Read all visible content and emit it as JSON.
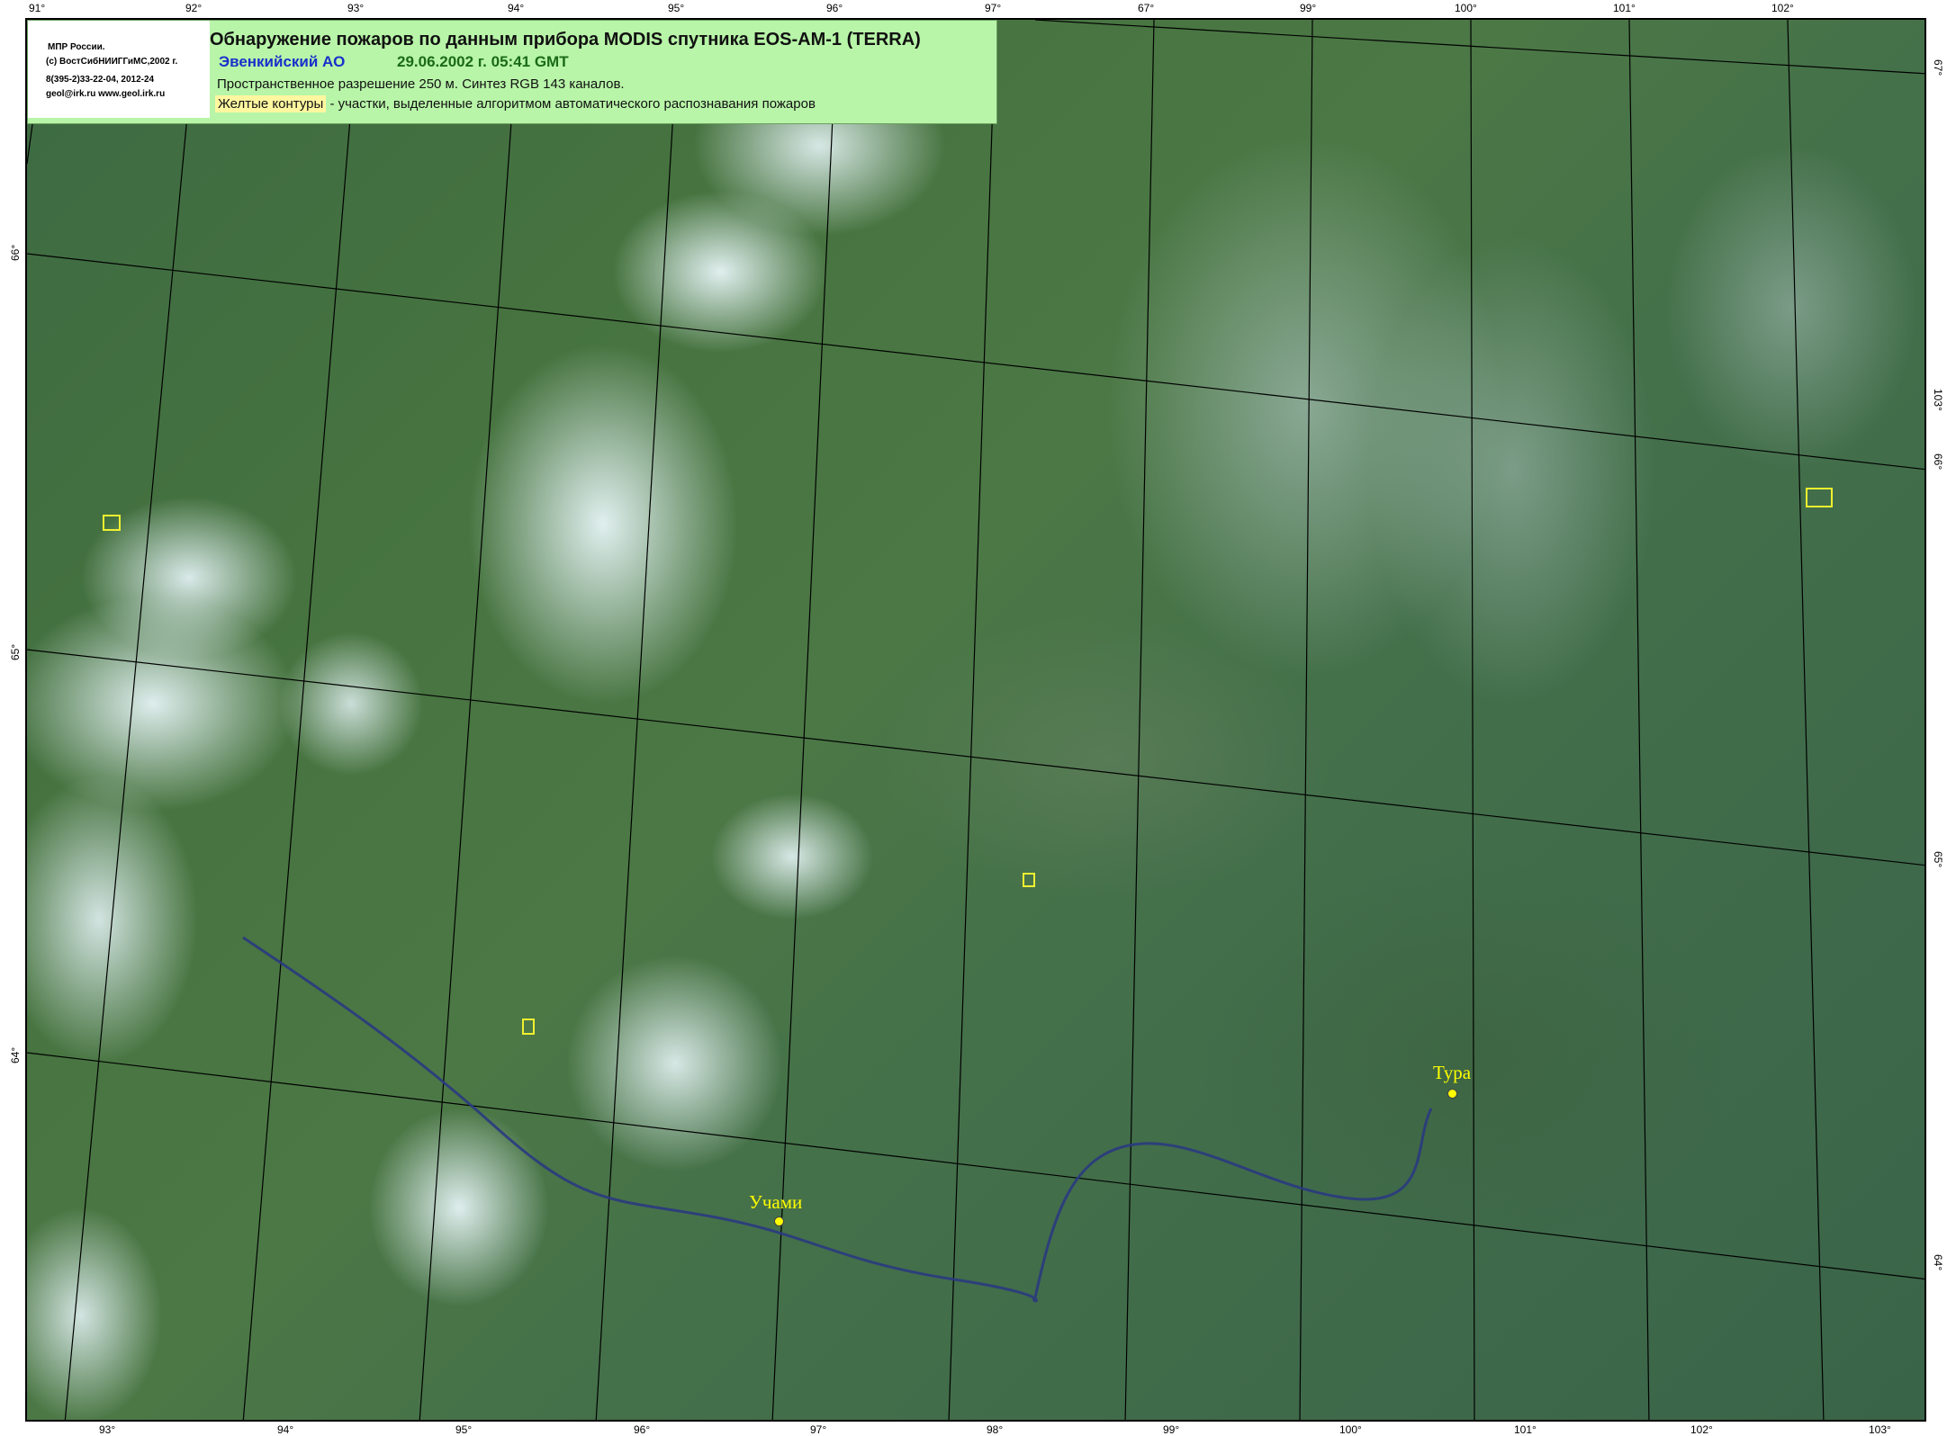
{
  "legend": {
    "org_lines": [
      "МПР России.",
      "(с) ВостСибНИИГГиМС,2002 г.",
      "8(395-2)33-22-04, 2012-24",
      "geol@irk.ru  www.geol.irk.ru"
    ],
    "title": "Обнаружение пожаров по данным прибора MODIS спутника EOS-AM-1 (TERRA)",
    "region": "Эвенкийский АО",
    "datetime": "29.06.2002 г. 05:41 GMT",
    "resolution": "Пространственное разрешение 250 м. Синтез RGB 143 каналов.",
    "fire_legend_highlight": "Желтые контуры",
    "fire_legend_text": " - участки, выделенные алгоритмом автоматического распознавания пожаров"
  },
  "top_labels": [
    "91°",
    "92°",
    "93°",
    "94°",
    "95°",
    "96°",
    "97°",
    "67°",
    "99°",
    "100°",
    "101°",
    "102°"
  ],
  "bottom_labels": [
    "93°",
    "94°",
    "95°",
    "96°",
    "97°",
    "98°",
    "99°",
    "100°",
    "101°",
    "102°",
    "103°"
  ],
  "left_labels": [
    "66°",
    "65°",
    "64°"
  ],
  "right_labels": [
    "67°",
    "103°",
    "66°",
    "65°",
    "64°"
  ],
  "towns": [
    {
      "name": "Тура"
    },
    {
      "name": "Учами"
    }
  ],
  "colors": {
    "fire_contour": "#f0f030",
    "town_marker": "#ffff00",
    "legend_bg": "#b8f5a8",
    "region_text": "#1a2fcc",
    "datetime_text": "#1a6a1a"
  }
}
